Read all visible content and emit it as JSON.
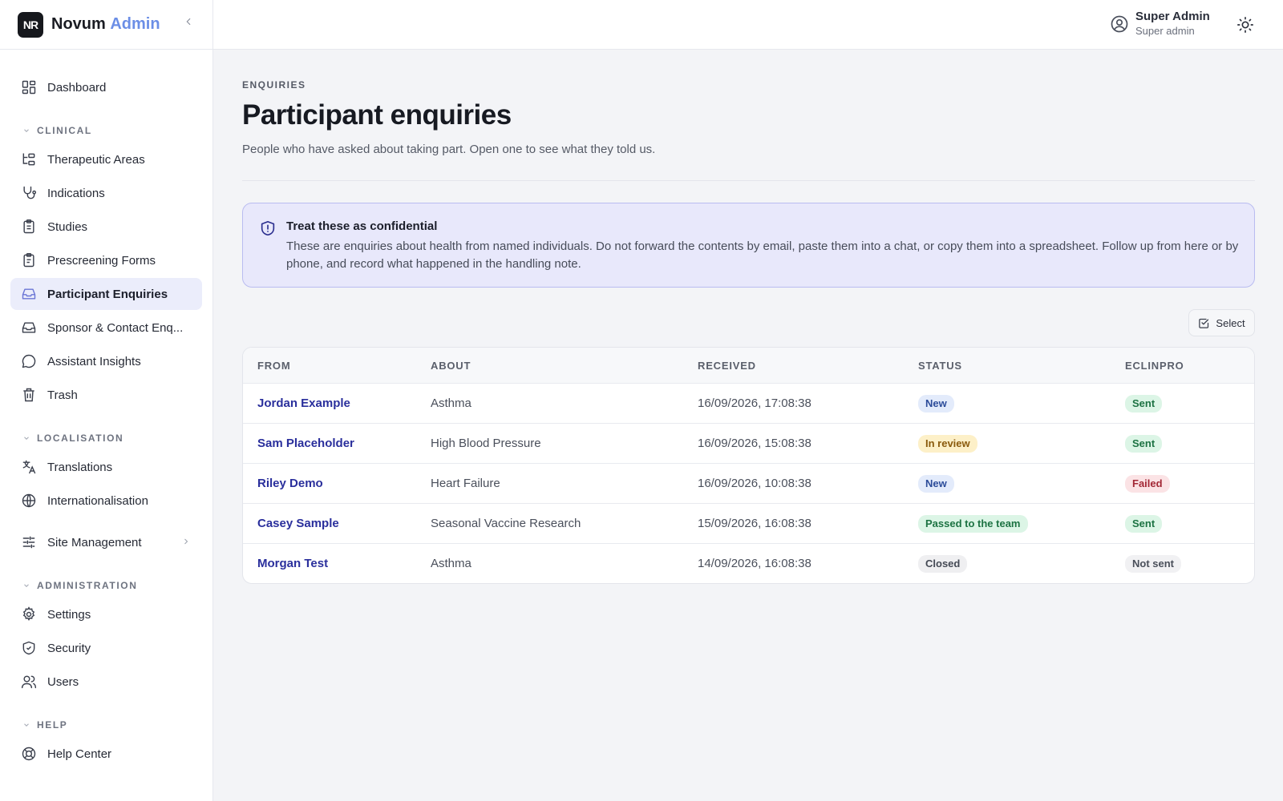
{
  "brand": {
    "logo": "NR",
    "name": "Novum",
    "accent": "Admin"
  },
  "sidebar": {
    "dashboard": "Dashboard",
    "sections": {
      "clinical": "CLINICAL",
      "localisation": "LOCALISATION",
      "administration": "ADMINISTRATION",
      "help": "HELP"
    },
    "items": {
      "therapeutic_areas": "Therapeutic Areas",
      "indications": "Indications",
      "studies": "Studies",
      "prescreening_forms": "Prescreening Forms",
      "participant_enquiries": "Participant Enquiries",
      "sponsor_enquiries": "Sponsor & Contact Enq...",
      "assistant_insights": "Assistant Insights",
      "trash": "Trash",
      "translations": "Translations",
      "internationalisation": "Internationalisation",
      "site_management": "Site Management",
      "settings": "Settings",
      "security": "Security",
      "users": "Users",
      "help_center": "Help Center"
    }
  },
  "header": {
    "user_name": "Super Admin",
    "user_role": "Super admin"
  },
  "page": {
    "eyebrow": "ENQUIRIES",
    "title": "Participant enquiries",
    "subtitle": "People who have asked about taking part. Open one to see what they told us."
  },
  "alert": {
    "title": "Treat these as confidential",
    "body": "These are enquiries about health from named individuals. Do not forward the contents by email, paste them into a chat, or copy them into a spreadsheet. Follow up from here or by phone, and record what happened in the handling note."
  },
  "toolbar": {
    "select_label": "Select"
  },
  "table": {
    "columns": [
      "FROM",
      "ABOUT",
      "RECEIVED",
      "STATUS",
      "ECLINPRO"
    ],
    "rows": [
      {
        "from": "Jordan Example",
        "about": "Asthma",
        "received": "16/09/2026, 17:08:38",
        "status": "New",
        "status_kind": "new",
        "eclinpro": "Sent",
        "eclinpro_kind": "sent"
      },
      {
        "from": "Sam Placeholder",
        "about": "High Blood Pressure",
        "received": "16/09/2026, 15:08:38",
        "status": "In review",
        "status_kind": "review",
        "eclinpro": "Sent",
        "eclinpro_kind": "sent"
      },
      {
        "from": "Riley Demo",
        "about": "Heart Failure",
        "received": "16/09/2026, 10:08:38",
        "status": "New",
        "status_kind": "new",
        "eclinpro": "Failed",
        "eclinpro_kind": "failed"
      },
      {
        "from": "Casey Sample",
        "about": "Seasonal Vaccine Research",
        "received": "15/09/2026, 16:08:38",
        "status": "Passed to the team",
        "status_kind": "passed",
        "eclinpro": "Sent",
        "eclinpro_kind": "sent"
      },
      {
        "from": "Morgan Test",
        "about": "Asthma",
        "received": "14/09/2026, 16:08:38",
        "status": "Closed",
        "status_kind": "closed",
        "eclinpro": "Not sent",
        "eclinpro_kind": "notsent"
      }
    ]
  },
  "colors": {
    "accent": "#6b8ee6",
    "link": "#2a2f9c",
    "active_nav_bg": "#ebedfb",
    "alert_bg": "#e8e8fb",
    "alert_border": "#b9bcf0"
  },
  "icons": {
    "dashboard": "layout-grid-icon",
    "therapeutic_areas": "hierarchy-icon",
    "indications": "stethoscope-icon",
    "studies": "clipboard-icon",
    "prescreening_forms": "clipboard-list-icon",
    "participant_enquiries": "inbox-icon",
    "sponsor_enquiries": "inbox-icon",
    "assistant_insights": "chat-bubble-icon",
    "trash": "trash-icon",
    "translations": "translate-icon",
    "internationalisation": "globe-icon",
    "site_management": "sliders-icon",
    "settings": "gear-icon",
    "security": "shield-check-icon",
    "users": "users-icon",
    "help_center": "lifebuoy-icon",
    "alert": "shield-alert-icon",
    "user": "user-circle-icon",
    "theme": "sun-icon",
    "select": "checkbox-icon"
  }
}
